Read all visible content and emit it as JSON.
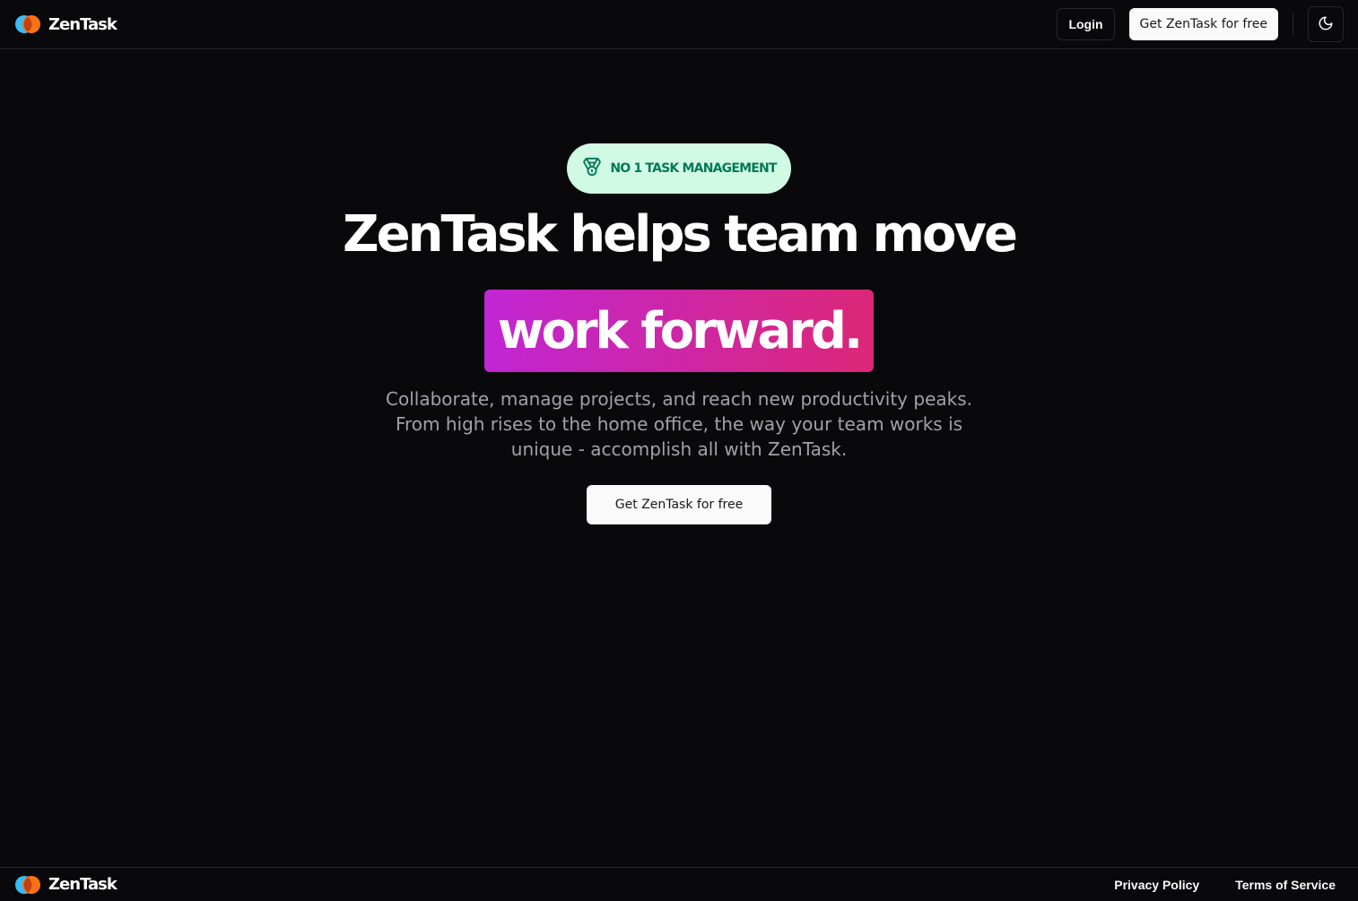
{
  "header": {
    "brand_name": "ZenTask",
    "logo_icon": "zentask-logo-icon",
    "login_label": "Login",
    "cta_label": "Get ZenTask for free",
    "theme_toggle_icon": "moon-icon"
  },
  "hero": {
    "badge_icon": "medal-icon",
    "badge_text": "NO 1 TASK MANAGEMENT",
    "headline": "ZenTask helps team move",
    "highlight": "work forward.",
    "subtitle": "Collaborate, manage projects, and reach new productivity peaks. From high rises to the home office, the way your team works is unique - accomplish all with ZenTask.",
    "cta_label": "Get ZenTask for free"
  },
  "footer": {
    "brand_name": "ZenTask",
    "links": [
      {
        "label": "Privacy Policy"
      },
      {
        "label": "Terms of Service"
      }
    ]
  },
  "colors": {
    "background": "#09090b",
    "border": "#27272a",
    "badge_bg": "#d1fae5",
    "badge_text": "#047857",
    "gradient_start": "#c026d3",
    "gradient_end": "#db2777",
    "logo_blue": "#38bdf8",
    "logo_orange": "#f97316"
  }
}
